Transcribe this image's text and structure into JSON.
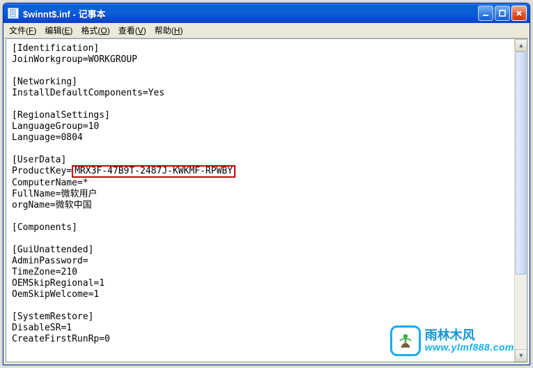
{
  "title": "$winnt$.inf - 记事本",
  "menus": {
    "file": {
      "label": "文件",
      "accel": "F"
    },
    "edit": {
      "label": "编辑",
      "accel": "E"
    },
    "format": {
      "label": "格式",
      "accel": "O"
    },
    "view": {
      "label": "查看",
      "accel": "V"
    },
    "help": {
      "label": "帮助",
      "accel": "H"
    }
  },
  "content": {
    "sec1": "[Identification]",
    "l1": "JoinWorkgroup=WORKGROUP",
    "sec2": "[Networking]",
    "l2": "InstallDefaultComponents=Yes",
    "sec3": "[RegionalSettings]",
    "l3": "LanguageGroup=10",
    "l4": "Language=0804",
    "sec4": "[UserData]",
    "l5a": "ProductKey=",
    "l5b": "MRX3F-47B9T-2487J-KWKMF-RPWBY",
    "l6": "ComputerName=*",
    "l7": "FullName=微软用户",
    "l8": "orgName=微软中国",
    "sec5": "[Components]",
    "sec6": "[GuiUnattended]",
    "l9": "AdminPassword=",
    "l10": "TimeZone=210",
    "l11": "OEMSkipRegional=1",
    "l12": "OemSkipWelcome=1",
    "sec7": "[SystemRestore]",
    "l13": "DisableSR=1",
    "l14": "CreateFirstRunRp=0"
  },
  "watermark": {
    "cn": "雨林木风",
    "url": "www.ylmf888.com"
  }
}
